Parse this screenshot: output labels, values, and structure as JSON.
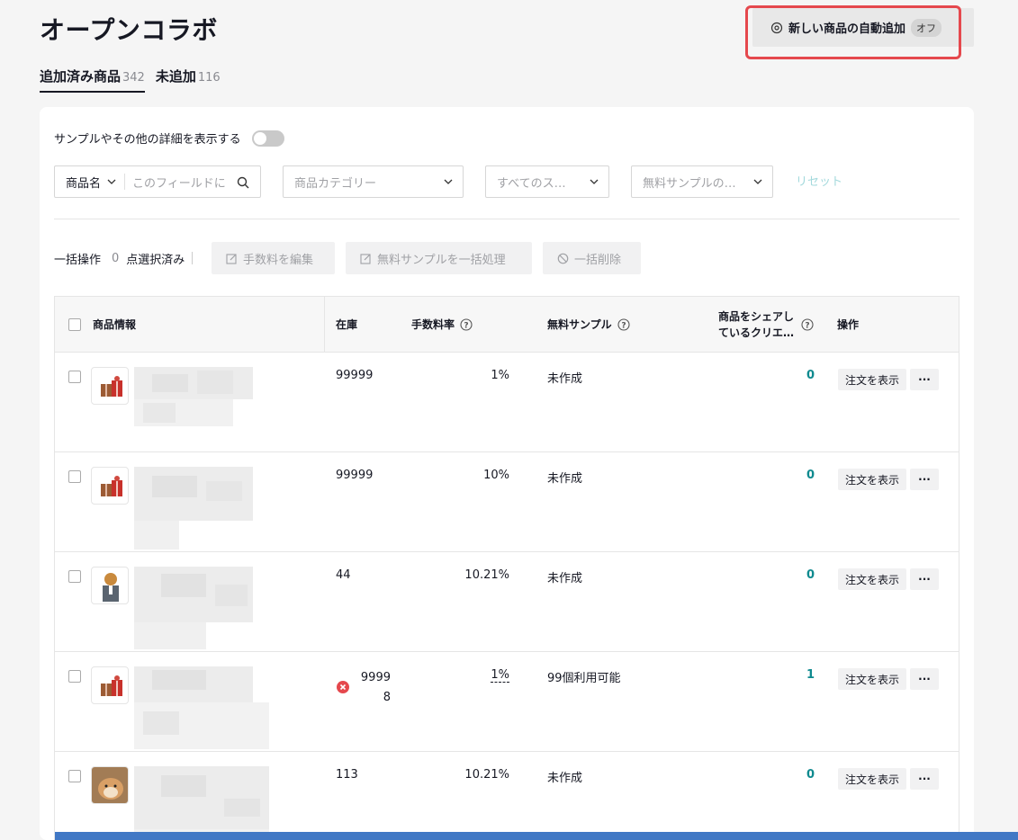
{
  "header": {
    "title": "オープンコラボ",
    "auto_add_label": "新しい商品の自動追加",
    "auto_add_status": "オフ"
  },
  "tabs": [
    {
      "label": "追加済み商品",
      "count": "342"
    },
    {
      "label": "未追加",
      "count": "116"
    }
  ],
  "toggle_label": "サンプルやその他の詳細を表示する",
  "filters": {
    "product_name_label": "商品名",
    "search_placeholder": "このフィールドに",
    "category_placeholder": "商品カテゴリー",
    "status_placeholder": "すべてのス…",
    "free_sample_placeholder": "無料サンプルの…",
    "reset_label": "リセット"
  },
  "bulk": {
    "label": "一括操作",
    "count": "0",
    "selected_label": "点選択済み",
    "edit_commission": "手数料を編集",
    "bulk_free_sample": "無料サンプルを一括処理",
    "bulk_delete": "一括削除"
  },
  "table": {
    "columns": {
      "product_info": "商品情報",
      "stock": "在庫",
      "commission": "手数料率",
      "free_sample": "無料サンプル",
      "creators_line1": "商品をシェアし",
      "creators_line2": "ているクリエ…",
      "actions": "操作"
    },
    "view_orders_label": "注文を表示",
    "more_label": "···",
    "rows": [
      {
        "stock": "99999",
        "commission": "1%",
        "free_sample": "未作成",
        "creators": "0",
        "thumb": "gift"
      },
      {
        "stock": "99999",
        "commission": "10%",
        "free_sample": "未作成",
        "creators": "0",
        "thumb": "gift"
      },
      {
        "stock": "44",
        "commission": "10.21%",
        "free_sample": "未作成",
        "creators": "0",
        "thumb": "dog-suit"
      },
      {
        "stock_line1": "9999",
        "stock_line2": "8",
        "commission": "1%",
        "free_sample": "99個利用可能",
        "creators": "1",
        "thumb": "gift",
        "warning": true
      },
      {
        "stock": "113",
        "commission": "10.21%",
        "free_sample": "未作成",
        "creators": "0",
        "thumb": "shiba"
      }
    ]
  },
  "colors": {
    "accent_teal": "#0f8a8f",
    "highlight_red": "#e5484d",
    "error_red": "#e5484d",
    "bottom_bar": "#4178c5"
  }
}
